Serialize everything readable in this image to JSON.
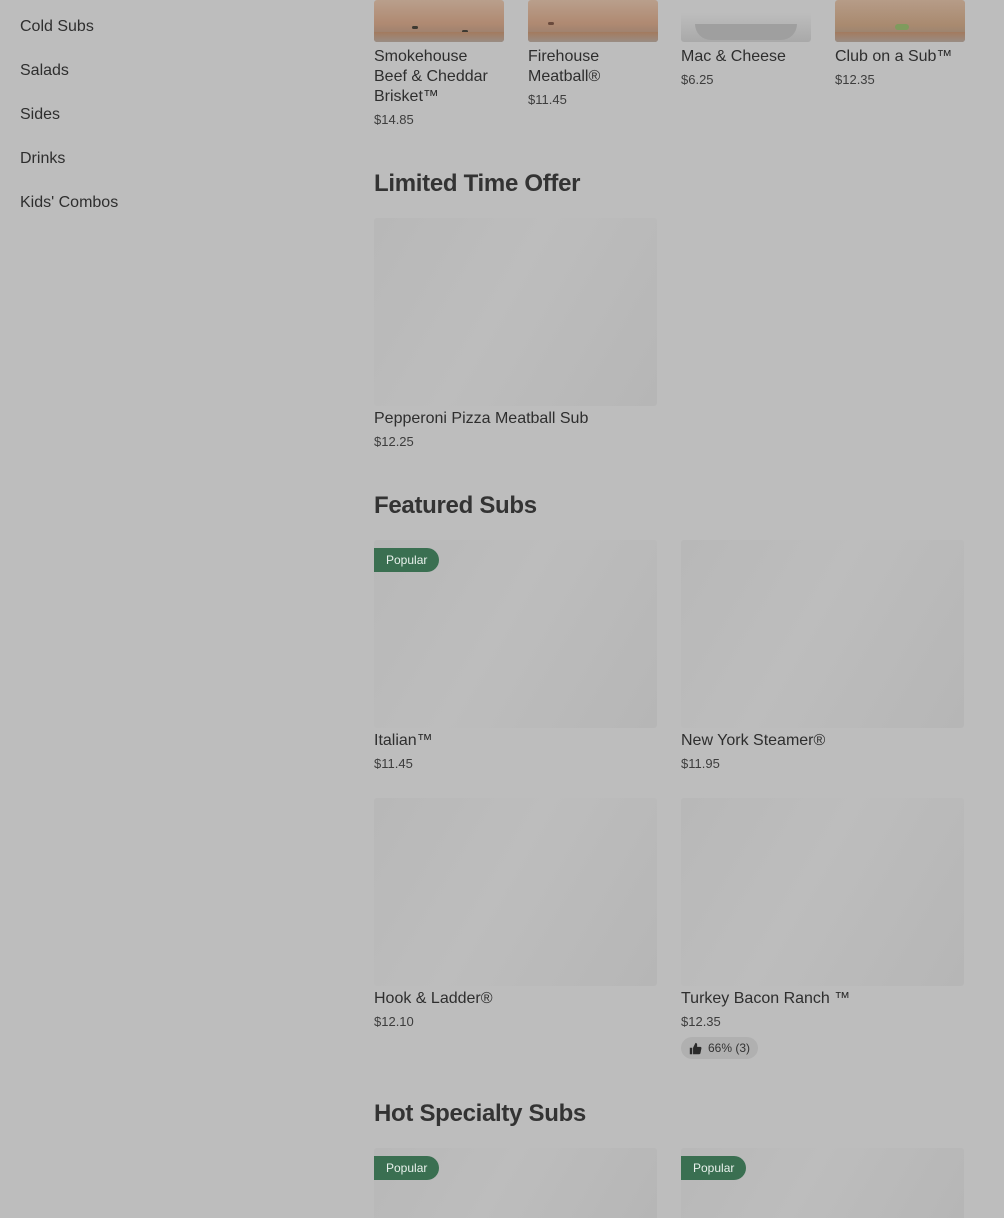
{
  "sidebar": {
    "items": [
      {
        "label": "Cold Subs"
      },
      {
        "label": "Salads"
      },
      {
        "label": "Sides"
      },
      {
        "label": "Drinks"
      },
      {
        "label": "Kids' Combos"
      }
    ]
  },
  "top_row": [
    {
      "name": "Smokehouse Beef & Cheddar Brisket™",
      "price": "$14.85"
    },
    {
      "name": "Firehouse Meatball®",
      "price": "$11.45"
    },
    {
      "name": "Mac & Cheese",
      "price": "$6.25"
    },
    {
      "name": "Club on a Sub™",
      "price": "$12.35"
    }
  ],
  "limited_time": {
    "title": "Limited Time Offer",
    "items": [
      {
        "name": "Pepperoni Pizza Meatball Sub",
        "price": "$12.25"
      }
    ]
  },
  "featured": {
    "title": "Featured Subs",
    "items": [
      {
        "name": "Italian™",
        "price": "$11.45",
        "badge": "Popular"
      },
      {
        "name": "New York Steamer®",
        "price": "$11.95"
      },
      {
        "name": "Hook & Ladder®",
        "price": "$12.10"
      },
      {
        "name": "Turkey Bacon Ranch ™",
        "price": "$12.35",
        "rating": "66% (3)"
      }
    ]
  },
  "hot_specialty": {
    "title": "Hot Specialty Subs",
    "items": [
      {
        "badge": "Popular"
      },
      {
        "badge": "Popular"
      }
    ]
  },
  "colors": {
    "overlay_bg": "#bdbdbd",
    "badge_green": "#3a6f51"
  }
}
